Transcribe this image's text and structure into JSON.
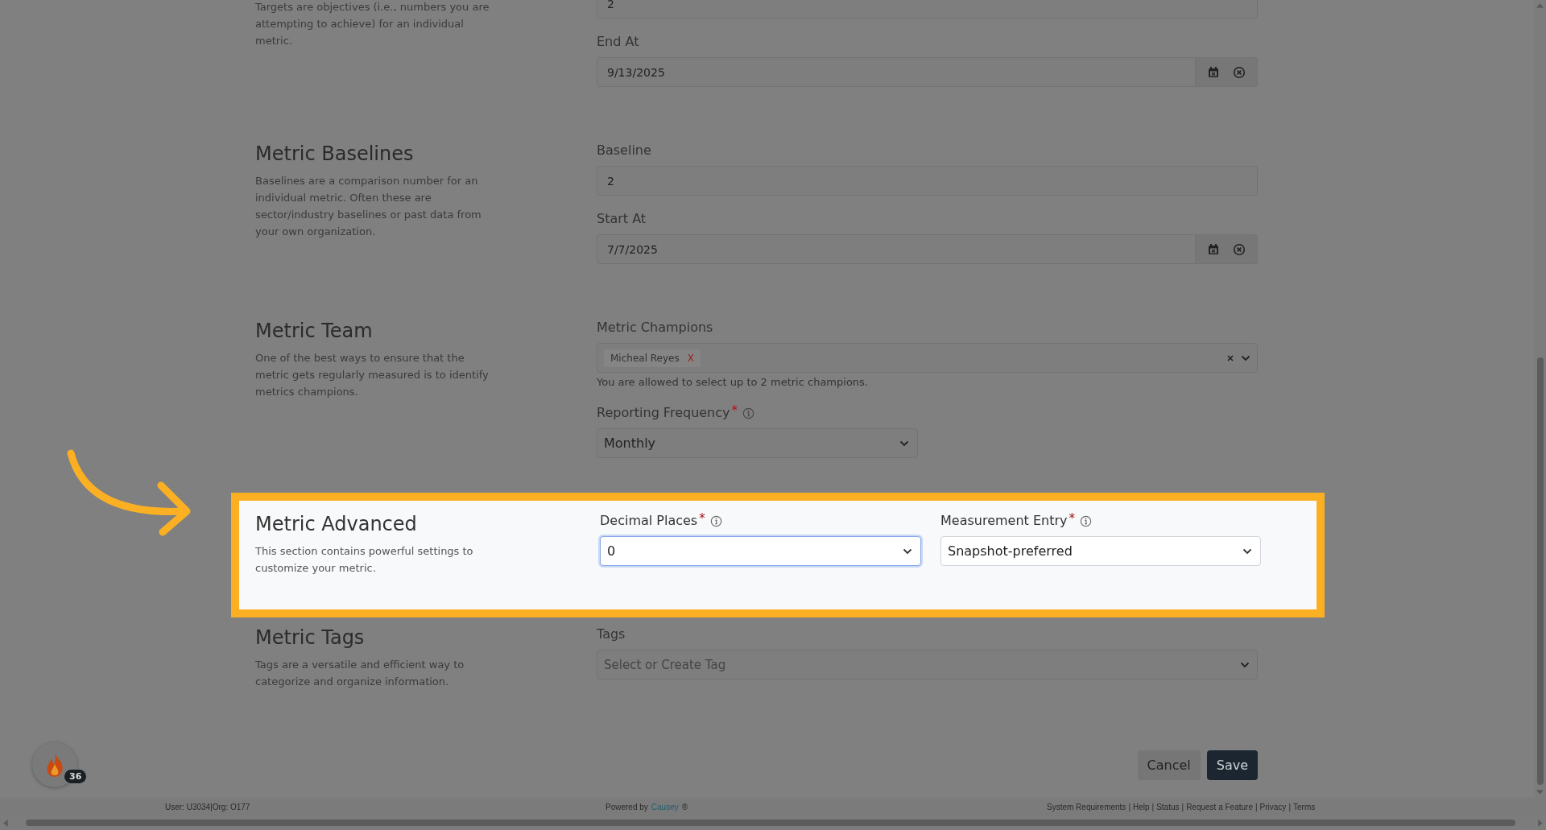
{
  "targets": {
    "description": "Targets are objectives (i.e., numbers you are attempting to achieve) for an individual metric.",
    "value": "2",
    "end_at": {
      "label": "End At",
      "value": "9/13/2025"
    }
  },
  "baselines": {
    "title": "Metric Baselines",
    "description": "Baselines are a comparison number for an individual metric. Often these are sector/industry baselines or past data from your own organization.",
    "baseline": {
      "label": "Baseline",
      "value": "2"
    },
    "start_at": {
      "label": "Start At",
      "value": "7/7/2025"
    }
  },
  "team": {
    "title": "Metric Team",
    "description": "One of the best ways to ensure that the metric gets regularly measured is to identify metrics champions.",
    "champions": {
      "label": "Metric Champions",
      "chips": [
        {
          "label": "Micheal Reyes",
          "remove": "X"
        }
      ],
      "hint": "You are allowed to select up to 2 metric champions."
    },
    "frequency": {
      "label": "Reporting Frequency",
      "required_mark": "*",
      "value": "Monthly"
    }
  },
  "advanced": {
    "title": "Metric Advanced",
    "description": "This section contains powerful settings to customize your metric.",
    "highlighted": true,
    "fields": [
      {
        "label": "Decimal Places",
        "required_mark": "*",
        "value": "0",
        "focused": true
      },
      {
        "label": "Measurement Entry",
        "required_mark": "*",
        "value": "Snapshot-preferred",
        "focused": false
      }
    ]
  },
  "tags": {
    "title": "Metric Tags",
    "description": "Tags are a versatile and efficient way to categorize and organize information.",
    "field": {
      "label": "Tags",
      "placeholder": "Select or Create Tag"
    }
  },
  "actions": [
    {
      "kind": "secondary",
      "label": "Cancel"
    },
    {
      "kind": "primary",
      "label": "Save"
    }
  ],
  "notification": {
    "count": "36"
  },
  "footer": {
    "user": "User: U3034|Org: O177",
    "powered_by": "Powered by",
    "brand": "Causey",
    "brand_mark": "®",
    "separator": "|",
    "links": [
      "System Requirements",
      "Help",
      "Status",
      "Request a Feature",
      "Privacy",
      "Terms"
    ]
  }
}
